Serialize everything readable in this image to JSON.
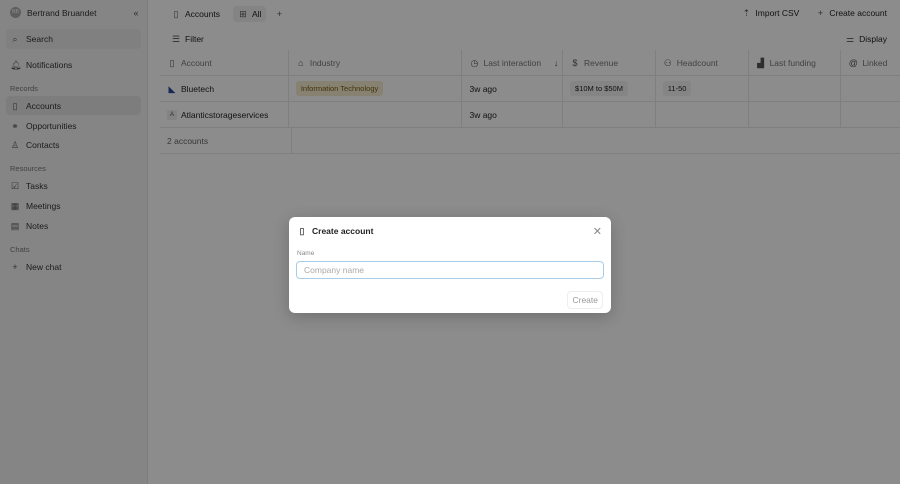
{
  "sidebar": {
    "user": "Bertrand Bruandet",
    "user_initials": "BB",
    "search": "Search",
    "notifications": "Notifications",
    "records_label": "Records",
    "records": [
      "Accounts",
      "Opportunities",
      "Contacts"
    ],
    "resources_label": "Resources",
    "resources": [
      "Tasks",
      "Meetings",
      "Notes"
    ],
    "chats_label": "Chats",
    "new_chat": "New chat"
  },
  "topbar": {
    "title": "Accounts",
    "view": "All",
    "import": "Import CSV",
    "create": "Create account"
  },
  "filterbar": {
    "filter": "Filter",
    "display": "Display"
  },
  "table": {
    "columns": [
      "Account",
      "Industry",
      "Last interaction",
      "Revenue",
      "Headcount",
      "Last funding",
      "Linked"
    ],
    "rows": [
      {
        "account": "Bluetech",
        "industry": "Information Technology",
        "last": "3w ago",
        "revenue": "$10M to $50M",
        "headcount": "11-50"
      },
      {
        "account": "Atlanticstorageservices",
        "logo": "A",
        "industry": "",
        "last": "3w ago",
        "revenue": "",
        "headcount": ""
      }
    ],
    "footer": "2 accounts"
  },
  "modal": {
    "title": "Create account",
    "name_label": "Name",
    "placeholder": "Company name",
    "create": "Create"
  }
}
